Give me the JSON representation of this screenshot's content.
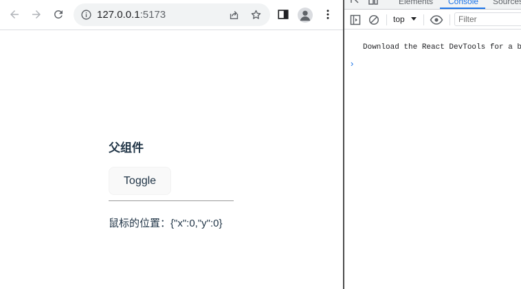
{
  "browser": {
    "url_host": "127.0.0.1",
    "url_port": ":5173"
  },
  "page": {
    "heading": "父组件",
    "toggle_label": "Toggle",
    "mouse_position_text": "鼠标的位置：{\"x\":0,\"y\":0}"
  },
  "devtools": {
    "tabs": [
      {
        "label": "Elements"
      },
      {
        "label": "Console",
        "active": true
      },
      {
        "label": "Sources"
      }
    ],
    "context": "top",
    "filter_placeholder": "Filter",
    "console_message": "Download the React DevTools for a better development experience",
    "prompt_symbol": "›"
  },
  "colors": {
    "accent": "#1a73e8",
    "text": "#213547",
    "toolbar_icons": "#5f6368"
  }
}
